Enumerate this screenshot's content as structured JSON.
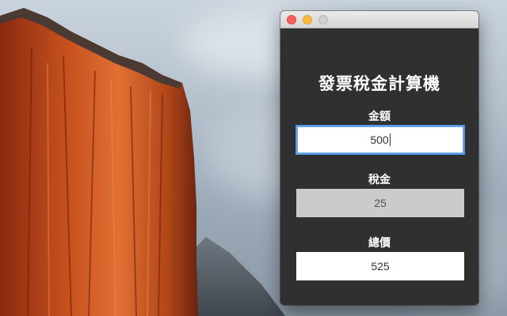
{
  "window": {
    "title_bar": {
      "buttons": [
        "close",
        "minimize",
        "maximize"
      ]
    }
  },
  "app": {
    "title": "發票稅金計算機",
    "fields": {
      "amount": {
        "label": "金額",
        "value": "500"
      },
      "tax": {
        "label": "稅金",
        "value": "25"
      },
      "total": {
        "label": "總價",
        "value": "525"
      }
    }
  },
  "colors": {
    "window_bg": "#303030",
    "close": "#fc605c",
    "minimize": "#fdbc40",
    "maximize_disabled": "#cfcfcf",
    "focus_ring": "#6aa3e8"
  },
  "icons": {
    "close": "close-traffic-light-icon",
    "minimize": "minimize-traffic-light-icon",
    "maximize": "maximize-traffic-light-icon"
  }
}
